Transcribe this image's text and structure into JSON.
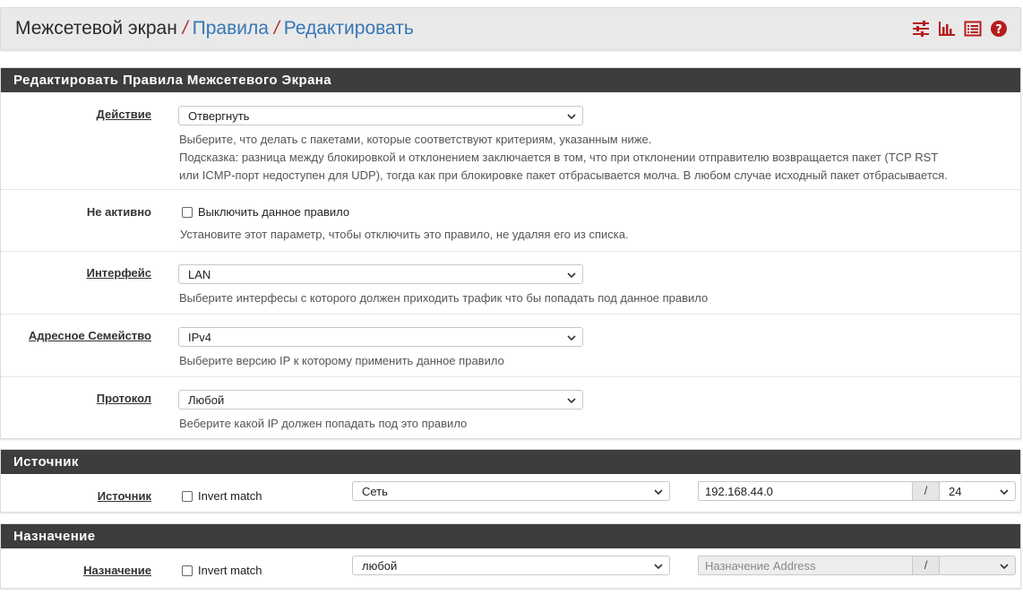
{
  "breadcrumb": {
    "root": "Межсетевой экран",
    "level1": "Правила",
    "level2": "Редактировать"
  },
  "header_icons": [
    "sliders-icon",
    "bar-chart-icon",
    "list-icon",
    "help-icon"
  ],
  "colors": {
    "accent": "#b71c1c",
    "link": "#3777b5",
    "panel_header": "#3d3d3d"
  },
  "edit_panel": {
    "title": "Редактировать Правила Межсетевого Экрана",
    "action": {
      "label": "Действие",
      "value": "Отвергнуть",
      "help1": "Выберите, что делать с пакетами, которые соответствуют критериям, указанным ниже.",
      "help2": "Подсказка: разница между блокировкой и отклонением заключается в том, что при отклонении отправителю возвращается пакет (TCP RST",
      "help3": "или ICMP-порт недоступен для UDP), тогда как при блокировке пакет отбрасывается молча. В любом случае исходный пакет отбрасывается."
    },
    "disabled": {
      "label": "Не активно",
      "checkbox_label": "Выключить данное правило",
      "help": "Установите этот параметр, чтобы отключить это правило, не удаляя его из списка."
    },
    "interface": {
      "label": "Интерфейс",
      "value": "LAN",
      "help": "Выберите интерфесы с которого должен приходить трафик что бы попадать под данное правило"
    },
    "address_family": {
      "label": "Адресное Семейство",
      "value": "IPv4",
      "help": "Выберите версию IP к которому применить данное правило"
    },
    "protocol": {
      "label": "Протокол",
      "value": "Любой",
      "help": "Веберите какой IP должен попадать под это правило"
    }
  },
  "source_panel": {
    "title": "Источник",
    "label": "Источник",
    "invert_label": "Invert match",
    "type_value": "Сеть",
    "address_value": "192.168.44.0",
    "slash": "/",
    "mask_value": "24"
  },
  "destination_panel": {
    "title": "Назначение",
    "label": "Назначение",
    "invert_label": "Invert match",
    "type_value": "любой",
    "address_placeholder": "Назначение Address",
    "slash": "/",
    "mask_value": ""
  }
}
